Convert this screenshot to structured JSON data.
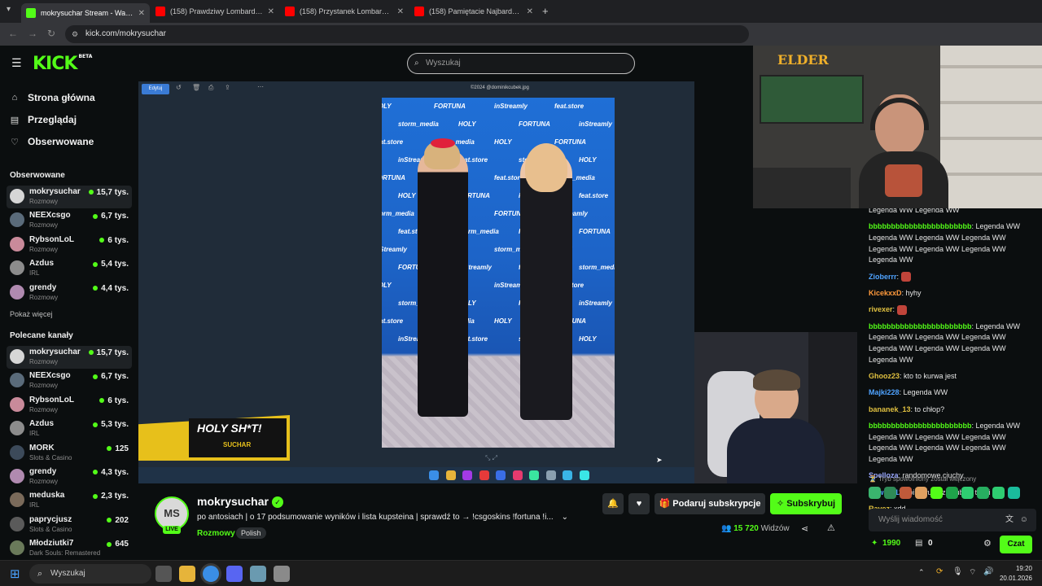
{
  "browser": {
    "tabs": [
      {
        "title": "mokrysuchar Stream - Watch",
        "active": true
      },
      {
        "title": "(158) Prawdziwy Lombard - Od",
        "active": false
      },
      {
        "title": "(158) Przystanek Lombard - Od",
        "active": false
      },
      {
        "title": "(158) Pamiętacie Najbardziej Po",
        "active": false
      }
    ],
    "new_tab_label": "+",
    "url": "kick.com/mokrysuchar"
  },
  "kick": {
    "logo": "KICK",
    "logo_badge": "BETA",
    "search_placeholder": "Wyszukaj",
    "main_nav": [
      {
        "label": "Strona główna",
        "icon": "home-icon"
      },
      {
        "label": "Przeglądaj",
        "icon": "browse-icon"
      },
      {
        "label": "Obserwowane",
        "icon": "heart-icon"
      }
    ],
    "followed_heading": "Obserwowane",
    "followed": [
      {
        "name": "mokrysuchar",
        "category": "Rozmowy",
        "viewers": "15,7 tys.",
        "color": "#d6d6d6"
      },
      {
        "name": "NEEXcsgo",
        "category": "Rozmowy",
        "viewers": "6,7 tys.",
        "color": "#5a6b7a"
      },
      {
        "name": "RybsonLoL",
        "category": "Rozmowy",
        "viewers": "6 tys.",
        "color": "#c98a9a"
      },
      {
        "name": "Azdus",
        "category": "IRL",
        "viewers": "5,4 tys.",
        "color": "#8c8c8c"
      },
      {
        "name": "grendy",
        "category": "Rozmowy",
        "viewers": "4,4 tys.",
        "color": "#b08ab0"
      }
    ],
    "show_more": "Pokaż więcej",
    "recommended_heading": "Polecane kanały",
    "recommended": [
      {
        "name": "mokrysuchar",
        "category": "Rozmowy",
        "viewers": "15,7 tys.",
        "color": "#d6d6d6"
      },
      {
        "name": "NEEXcsgo",
        "category": "Rozmowy",
        "viewers": "6,7 tys.",
        "color": "#5a6b7a"
      },
      {
        "name": "RybsonLoL",
        "category": "Rozmowy",
        "viewers": "6 tys.",
        "color": "#c98a9a"
      },
      {
        "name": "Azdus",
        "category": "IRL",
        "viewers": "5,3 tys.",
        "color": "#8c8c8c"
      },
      {
        "name": "MORK",
        "category": "Slots & Casino",
        "viewers": "125",
        "color": "#3c4a5a"
      },
      {
        "name": "grendy",
        "category": "Rozmowy",
        "viewers": "4,3 tys.",
        "color": "#b08ab0"
      },
      {
        "name": "meduska",
        "category": "IRL",
        "viewers": "2,3 tys.",
        "color": "#7a6a5a"
      },
      {
        "name": "paprycjusz",
        "category": "Slots & Casino",
        "viewers": "202",
        "color": "#5a5a5a"
      },
      {
        "name": "Młodziutki7",
        "category": "Dark Souls: Remastered",
        "viewers": "645",
        "color": "#6a7a5a"
      }
    ],
    "player": {
      "viewer_filename": "©2024 @dominikcubek.jpg",
      "viewer_edit_label": "Edytuj",
      "wall_logos": [
        "HOLY",
        "FORTUNA",
        "inStreamly",
        "feat.store",
        "storm_media"
      ],
      "promo_title": "HOLY SH*T!",
      "promo_sub": "SUCHAR"
    },
    "stream": {
      "avatar_initials": "MS",
      "live_badge": "LIVE",
      "streamer": "mokrysuchar",
      "title": "po antosiach | o 17 podsumowanie wyników i lista kupsteina | sprawdź to → !csgoskins !fortuna !i...",
      "category": "Rozmowy",
      "language": "Polish",
      "gift_label": "Podaruj subskrypcje",
      "subscribe_label": "Subskrybuj",
      "viewers": "15 720",
      "viewers_label": "Widzów"
    },
    "chat": {
      "messages": [
        {
          "user": "",
          "text": "Legenda WW Legenda WW",
          "color": "#e6e6e6"
        },
        {
          "user": "bbbbbbbbbbbbbbbbbbbbbbb",
          "text": "Legenda WW Legenda WW Legenda WW Legenda WW Legenda WW Legenda WW Legenda WW Legenda WW",
          "color": "#53fc18"
        },
        {
          "user": "Zioberrr",
          "text": "",
          "color": "#4fa3ff"
        },
        {
          "user": "KicekxxD",
          "text": "hyhy",
          "color": "#ff9a3c"
        },
        {
          "user": "rivexer",
          "text": "",
          "color": "#e0c040"
        },
        {
          "user": "bbbbbbbbbbbbbbbbbbbbbbb",
          "text": "Legenda WW Legenda WW Legenda WW Legenda WW Legenda WW Legenda WW Legenda WW Legenda WW",
          "color": "#53fc18"
        },
        {
          "user": "Ghooz23",
          "text": "kto to kurwa jest",
          "color": "#e0c040"
        },
        {
          "user": "Majki228",
          "text": "Legenda WW",
          "color": "#4fa3ff"
        },
        {
          "user": "bananek_13",
          "text": "to chłop?",
          "color": "#e0c040"
        },
        {
          "user": "bbbbbbbbbbbbbbbbbbbbbbb",
          "text": "Legenda WW Legenda WW Legenda WW Legenda WW Legenda WW Legenda WW Legenda WW Legenda WW",
          "color": "#53fc18"
        },
        {
          "user": "Spelloza",
          "text": "randomowe ciuchy",
          "color": "#9aa8ff"
        },
        {
          "user": "Dawer_12",
          "text": "toila wude za suby z turcji",
          "color": "#4fa3ff"
        },
        {
          "user": "Ravez",
          "text": "xdd",
          "color": "#e0c040"
        }
      ],
      "slow_mode": "Tryb spowolniony został włączony",
      "input_placeholder": "Wyślij wiadomość",
      "points": "1990",
      "bets": "0",
      "chat_button": "Czat"
    }
  },
  "cam_overlay": {
    "logo_text": "ELDER"
  },
  "taskbar": {
    "search_placeholder": "Wyszukaj",
    "time": "19:20",
    "date": "20.01.2026"
  }
}
